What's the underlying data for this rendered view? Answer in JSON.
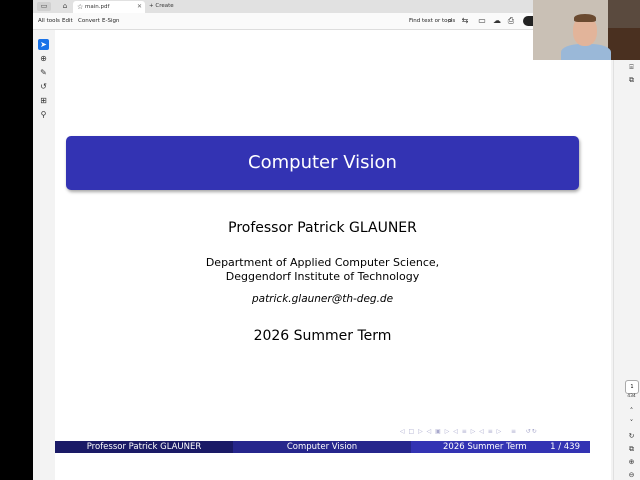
{
  "tabbar": {
    "tab_title": "main.pdf",
    "new_tab_label": "Create"
  },
  "toolbar": {
    "menus": [
      "All tools",
      "Edit",
      "Convert",
      "E-Sign"
    ],
    "find_label": "Find text or tools"
  },
  "slide": {
    "title": "Computer Vision",
    "author": "Professor Patrick GLAUNER",
    "institute_line1": "Department of Applied Computer Science,",
    "institute_line2": "Deggendorf Institute of Technology",
    "email": "patrick.glauner@th-deg.de",
    "date": "2026 Summer Term",
    "footer": {
      "author": "Professor Patrick GLAUNER",
      "title": "Computer Vision",
      "term": "2026 Summer Term",
      "page": "1 / 439"
    }
  },
  "viewer": {
    "current_page": "1",
    "total_pages": "434"
  },
  "colors": {
    "beamer_dark": "#1a1a66",
    "beamer_mid": "#26268c",
    "beamer_light": "#3333b3",
    "accent": "#1a73e8"
  }
}
